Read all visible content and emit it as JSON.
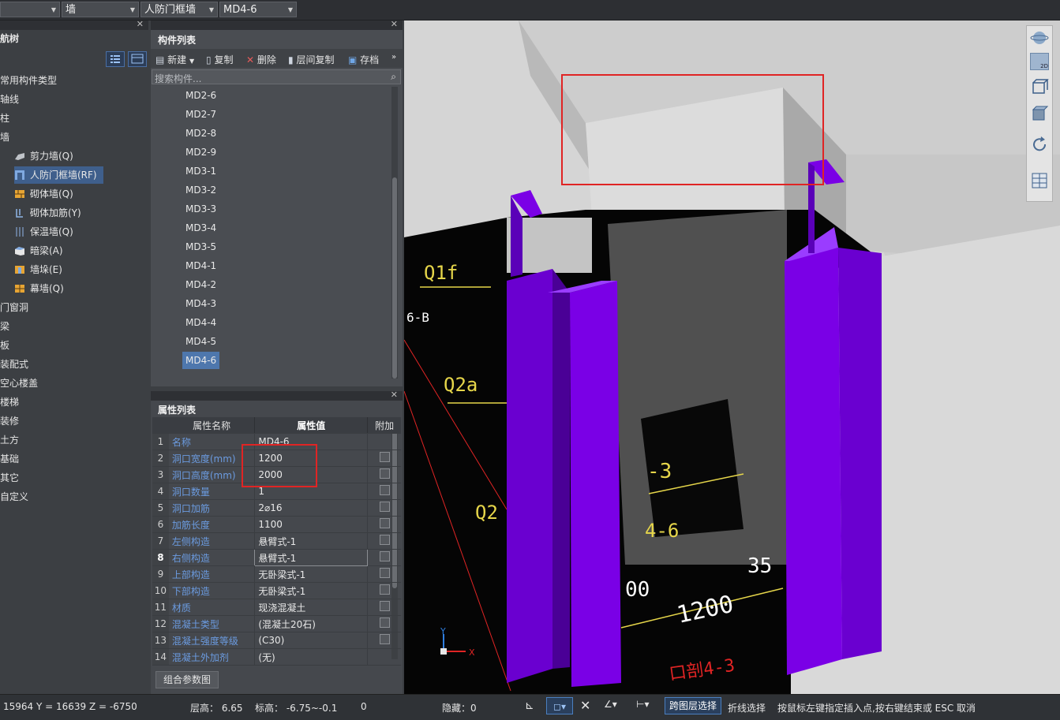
{
  "topbar": {
    "combo1": "",
    "combo2": "墙",
    "combo3": "人防门框墙",
    "combo4": "MD4-6"
  },
  "tree": {
    "title": "导航树",
    "title_visible": "航树",
    "items": [
      "常用构件类型",
      "轴线",
      "柱",
      "墙",
      "门窗洞",
      "梁",
      "板",
      "装配式",
      "空心楼盖",
      "楼梯",
      "装修",
      "土方",
      "基础",
      "其它",
      "自定义"
    ],
    "wall_children": [
      "剪力墙(Q)",
      "人防门框墙(RF)",
      "砌体墙(Q)",
      "砌体加筋(Y)",
      "保温墙(Q)",
      "暗梁(A)",
      "墙垛(E)",
      "幕墙(Q)"
    ]
  },
  "complist": {
    "title": "构件列表",
    "toolbar": {
      "new": "新建",
      "copy": "复制",
      "delete": "删除",
      "floor_copy": "层间复制",
      "save": "存档"
    },
    "search_placeholder": "搜索构件...",
    "items": [
      "MD2-6",
      "MD2-7",
      "MD2-8",
      "MD2-9",
      "MD3-1",
      "MD3-2",
      "MD3-3",
      "MD3-4",
      "MD3-5",
      "MD4-1",
      "MD4-2",
      "MD4-3",
      "MD4-4",
      "MD4-5",
      "MD4-6"
    ],
    "selected": "MD4-6"
  },
  "props": {
    "title": "属性列表",
    "headers": [
      "属性名称",
      "属性值",
      "附加"
    ],
    "rows": [
      {
        "n": "1",
        "k": "名称",
        "v": "MD4-6",
        "cb": false
      },
      {
        "n": "2",
        "k": "洞口宽度(mm)",
        "v": "1200",
        "cb": true
      },
      {
        "n": "3",
        "k": "洞口高度(mm)",
        "v": "2000",
        "cb": true
      },
      {
        "n": "4",
        "k": "洞口数量",
        "v": "1",
        "cb": true
      },
      {
        "n": "5",
        "k": "洞口加筋",
        "v": "2⌀16",
        "cb": true
      },
      {
        "n": "6",
        "k": "加筋长度",
        "v": "1100",
        "cb": true
      },
      {
        "n": "7",
        "k": "左侧构造",
        "v": "悬臂式-1",
        "cb": true
      },
      {
        "n": "8",
        "k": "右侧构造",
        "v": "悬臂式-1",
        "cb": true
      },
      {
        "n": "9",
        "k": "上部构造",
        "v": "无卧梁式-1",
        "cb": true
      },
      {
        "n": "10",
        "k": "下部构造",
        "v": "无卧梁式-1",
        "cb": true
      },
      {
        "n": "11",
        "k": "材质",
        "v": "现浇混凝土",
        "cb": true
      },
      {
        "n": "12",
        "k": "混凝土类型",
        "v": "(混凝土20石)",
        "cb": true
      },
      {
        "n": "13",
        "k": "混凝土强度等级",
        "v": "(C30)",
        "cb": true
      },
      {
        "n": "14",
        "k": "混凝土外加剂",
        "v": "(无)",
        "cb": false
      }
    ],
    "bottom_button": "组合参数图"
  },
  "viewport": {
    "labels": [
      "Q1f",
      "6-B",
      "Q2a",
      "Q2",
      "-3",
      "4-6",
      "00",
      "1200",
      "35",
      "口剖4-3"
    ],
    "view_cube_label": "2D",
    "axis_x": "X",
    "axis_y": "Y"
  },
  "status": {
    "coords": "15964 Y = 16639 Z = -6750",
    "floor_height": "层高： 6.65",
    "elevation": "标高： -6.75~-0.1",
    "zero": "0",
    "hidden": "隐藏：0",
    "cross_floor": "跨图层选择",
    "polyline": "折线选择",
    "hint": "按鼠标左键指定插入点,按右键结束或 ESC 取消"
  }
}
